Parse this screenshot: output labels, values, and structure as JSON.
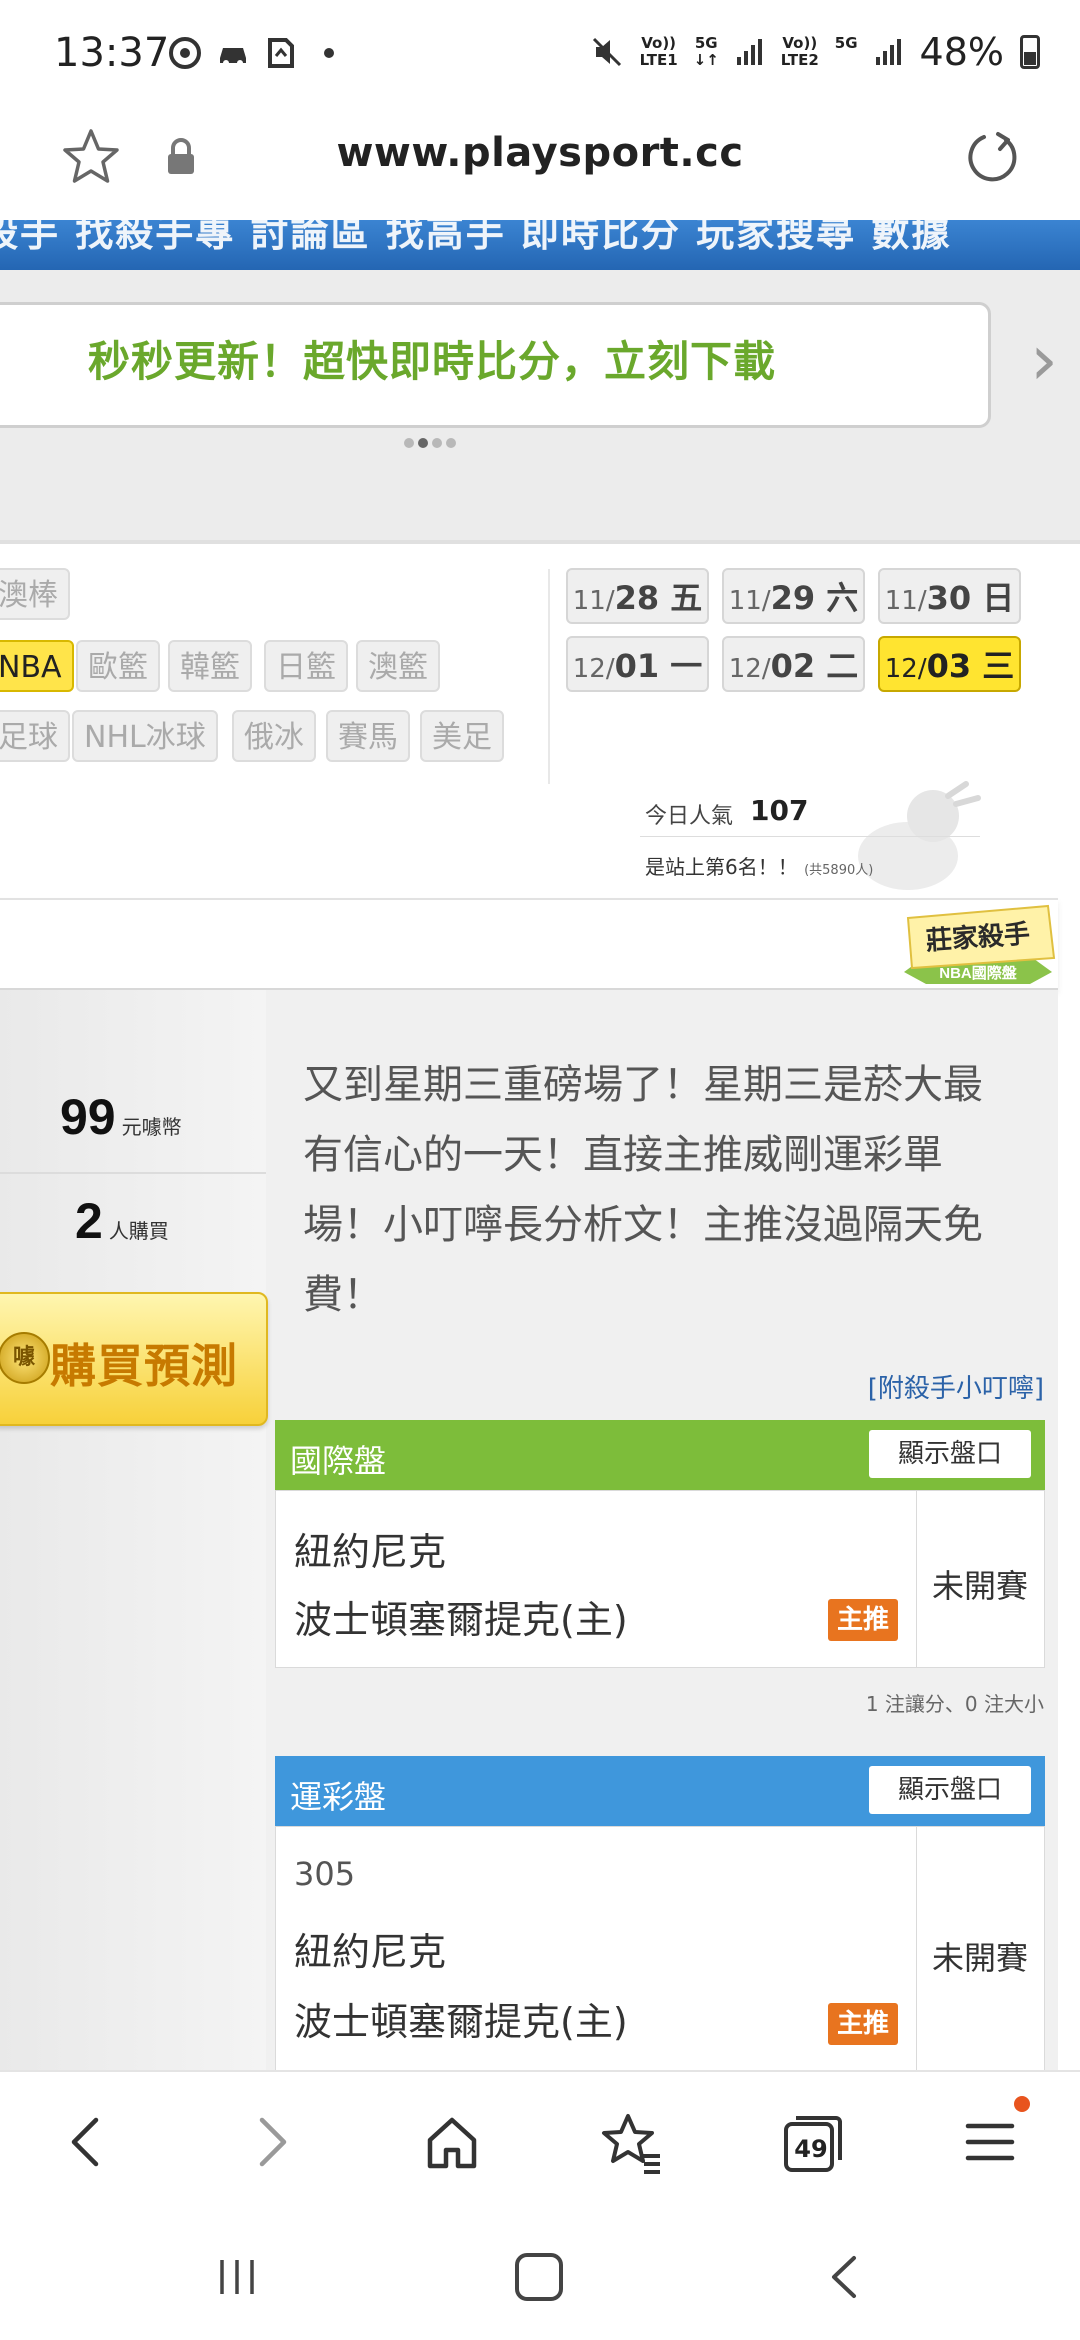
{
  "status_bar": {
    "time": "13:37",
    "left_icons": [
      "chrome-icon",
      "car-icon",
      "note-icon",
      "dot-icon"
    ],
    "network": [
      {
        "top": "Vo))",
        "bottom": "LTE1",
        "gen": "5G"
      },
      {
        "top": "Vo))",
        "bottom": "LTE2",
        "gen": "5G"
      }
    ],
    "battery": "48%"
  },
  "url_bar": {
    "url": "www.playsport.cc"
  },
  "site_nav": {
    "text": "殺手  找殺手專  討論區  找高手  即時比分  玩家搜尋  數據"
  },
  "banner": {
    "text": "秒秒更新！超快即時比分，立刻下載",
    "active_dot": 1,
    "dot_count": 4
  },
  "sport_tags": {
    "row1": [
      "澳棒"
    ],
    "row2": [
      "NBA",
      "歐籃",
      "韓籃",
      "日籃",
      "澳籃"
    ],
    "row3": [
      "足球",
      "NHL冰球",
      "俄冰",
      "賽馬",
      "美足"
    ],
    "active": "NBA"
  },
  "dates": [
    {
      "md": "11/",
      "day": "28",
      "dow": "五"
    },
    {
      "md": "11/",
      "day": "29",
      "dow": "六"
    },
    {
      "md": "11/",
      "day": "30",
      "dow": "日"
    },
    {
      "md": "12/",
      "day": "01",
      "dow": "一"
    },
    {
      "md": "12/",
      "day": "02",
      "dow": "二"
    },
    {
      "md": "12/",
      "day": "03",
      "dow": "三"
    }
  ],
  "selected_date_index": 5,
  "popularity": {
    "label": "今日人氣",
    "value": "107",
    "rank_text": "是站上第6名！！",
    "rank_small": "(共5890人)"
  },
  "badge": {
    "title": "莊家殺手",
    "subtitle": "NBA國際盤"
  },
  "seller": {
    "price": "99",
    "price_unit": "元噱幣",
    "buyers": "2",
    "buyers_unit": "人購買",
    "buy_button": "購買預測",
    "buy_coin": "噱"
  },
  "description": "又到星期三重磅場了！星期三是菸大最有信心的一天！直接主推威剛運彩單場！小叮嚀長分析文！主推沒過隔天免費！",
  "attach_link": "[附殺手小叮嚀]",
  "intl_odds": {
    "title": "國際盤",
    "show_button": "顯示盤口",
    "away": "紐約尼克",
    "home": "波士頓塞爾提克(主)",
    "pick": "主推",
    "status": "未開賽",
    "count_text": "1 注讓分、0 注大小"
  },
  "sports_lottery": {
    "title": "運彩盤",
    "show_button": "顯示盤口",
    "game_no": "305",
    "away": "紐約尼克",
    "home": "波士頓塞爾提克(主)",
    "pick": "主推",
    "status": "未開賽"
  },
  "toolbar": {
    "tab_count": "49",
    "has_notification": true
  },
  "colors": {
    "intl_header": "#7dbd3a",
    "lottery_header": "#3f97dc",
    "banner_text": "#6aa82c",
    "pick_badge": "#e8741f",
    "selected_date": "#ffe430"
  }
}
